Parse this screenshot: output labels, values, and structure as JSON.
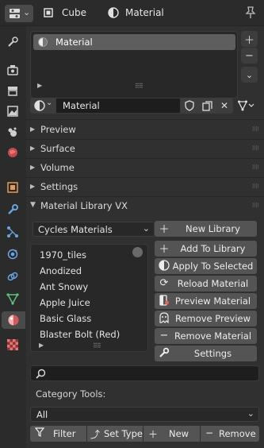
{
  "header": {
    "object_name": "Cube",
    "material_name": "Material"
  },
  "tabs": [
    {
      "name": "tool-tab"
    },
    {
      "name": "render-tab"
    },
    {
      "name": "output-tab"
    },
    {
      "name": "view-layer-tab"
    },
    {
      "name": "scene-tab"
    },
    {
      "name": "world-tab"
    },
    {
      "name": "object-tab"
    },
    {
      "name": "modifiers-tab"
    },
    {
      "name": "particles-tab"
    },
    {
      "name": "physics-tab"
    },
    {
      "name": "constraints-tab"
    },
    {
      "name": "data-tab"
    },
    {
      "name": "material-tab",
      "active": true
    },
    {
      "name": "texture-tab"
    }
  ],
  "material_slots": {
    "items": [
      "Material"
    ],
    "datablock_name": "Material"
  },
  "panels": {
    "preview": "Preview",
    "surface": "Surface",
    "volume": "Volume",
    "settings": "Settings",
    "library": "Material Library VX"
  },
  "library": {
    "selected": "Cycles Materials",
    "items": [
      "1970_tiles",
      "Anodized",
      "Ant Snowy",
      "Apple Juice",
      "Basic Glass",
      "Blaster Bolt (Red)"
    ],
    "buttons": {
      "new_library": "New Library",
      "add_to_library": "Add To Library",
      "apply_to_selected": "Apply To Selected",
      "reload_material": "Reload Material",
      "preview_material": "Preview Material",
      "remove_preview": "Remove Preview",
      "remove_material": "Remove Material",
      "settings": "Settings"
    },
    "search_value": "",
    "category_label": "Category Tools:",
    "category_selected": "All",
    "bottom": {
      "filter": "Filter",
      "set_type": "Set Type",
      "new": "New",
      "remove": "Remove"
    }
  },
  "colors": {
    "background": "#303030",
    "header": "#2b2b2b",
    "button": "#545454",
    "field": "#1d1d1d",
    "highlight": "#5e5e5e"
  }
}
